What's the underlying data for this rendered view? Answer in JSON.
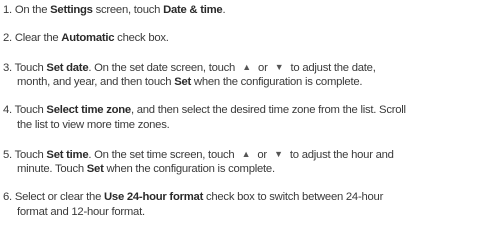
{
  "steps": [
    {
      "number": "1.",
      "lines": [
        [
          {
            "t": "On the "
          },
          {
            "t": "Settings",
            "b": true
          },
          {
            "t": " screen, touch "
          },
          {
            "t": "Date & time",
            "b": true
          },
          {
            "t": "."
          }
        ]
      ]
    },
    {
      "number": "2.",
      "lines": [
        [
          {
            "t": "Clear the "
          },
          {
            "t": "Automatic",
            "b": true
          },
          {
            "t": " check box."
          }
        ]
      ]
    },
    {
      "number": "3.",
      "lines": [
        [
          {
            "t": "Touch "
          },
          {
            "t": "Set date",
            "b": true
          },
          {
            "t": ". On the set date screen, touch "
          },
          {
            "icon": "triangle-up-icon",
            "g": "▲"
          },
          {
            "t": " or "
          },
          {
            "icon": "triangle-down-icon",
            "g": "▼"
          },
          {
            "t": " to adjust the date,"
          }
        ],
        [
          {
            "t": "month, and year, and then touch "
          },
          {
            "t": "Set",
            "b": true
          },
          {
            "t": " when the configuration is complete."
          }
        ]
      ]
    },
    {
      "number": "4.",
      "lines": [
        [
          {
            "t": "Touch "
          },
          {
            "t": "Select time zone",
            "b": true
          },
          {
            "t": ", and then select the desired time zone from the list. Scroll"
          }
        ],
        [
          {
            "t": "the list to view more time zones."
          }
        ]
      ]
    },
    {
      "number": "5.",
      "lines": [
        [
          {
            "t": "Touch "
          },
          {
            "t": "Set time",
            "b": true
          },
          {
            "t": ". On the set time screen, touch "
          },
          {
            "icon": "triangle-up-icon",
            "g": "▲"
          },
          {
            "t": " or "
          },
          {
            "icon": "triangle-down-icon",
            "g": "▼"
          },
          {
            "t": " to adjust the hour and"
          }
        ],
        [
          {
            "t": "minute. Touch "
          },
          {
            "t": "Set",
            "b": true
          },
          {
            "t": " when the configuration is complete."
          }
        ]
      ]
    },
    {
      "number": "6.",
      "lines": [
        [
          {
            "t": "Select or clear the "
          },
          {
            "t": "Use 24-hour format",
            "b": true
          },
          {
            "t": " check box to switch between 24-hour"
          }
        ],
        [
          {
            "t": "format and 12-hour format."
          }
        ]
      ]
    }
  ]
}
